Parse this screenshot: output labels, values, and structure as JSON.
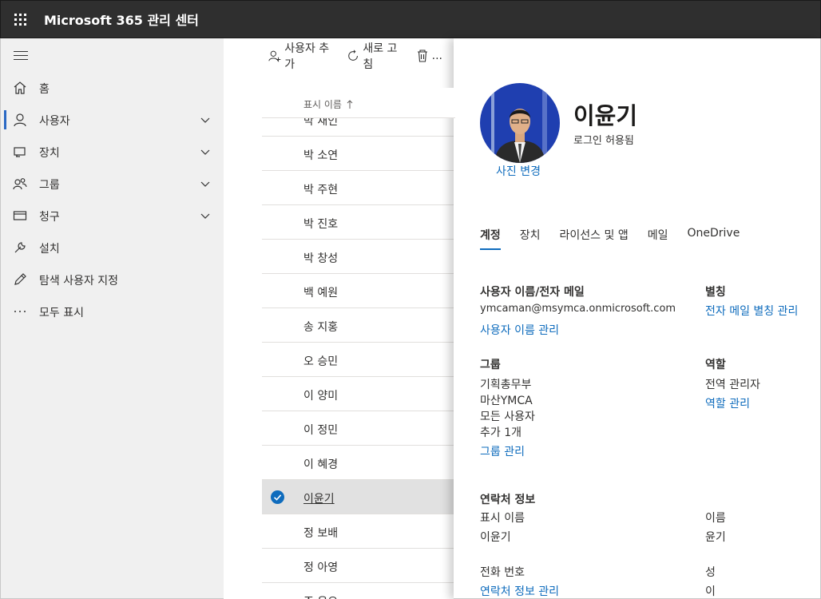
{
  "app": {
    "title": "Microsoft 365 관리 센터"
  },
  "sidebar": {
    "items": [
      {
        "label": "홈",
        "icon": "home-icon"
      },
      {
        "label": "사용자",
        "icon": "person-icon",
        "active": true,
        "expandable": true
      },
      {
        "label": "장치",
        "icon": "device-icon",
        "expandable": true
      },
      {
        "label": "그룹",
        "icon": "group-icon",
        "expandable": true
      },
      {
        "label": "청구",
        "icon": "billing-icon",
        "expandable": true
      },
      {
        "label": "설치",
        "icon": "wrench-icon"
      },
      {
        "label": "탐색 사용자 지정",
        "icon": "pencil-icon"
      },
      {
        "label": "모두 표시",
        "icon": "more-icon"
      }
    ]
  },
  "toolbar": {
    "add_user": "사용자 추가",
    "refresh": "새로 고침",
    "delete": "..."
  },
  "list": {
    "column_header": "표시 이름",
    "rows": [
      "박 재인",
      "박 소연",
      "박 주현",
      "박 진호",
      "박 창성",
      "백 예원",
      "송 지홍",
      "오 승민",
      "이 양미",
      "이 정민",
      "이 혜경",
      "이윤기",
      "정 보배",
      "정 아영",
      "조 은오"
    ],
    "selected_index": 11
  },
  "panel": {
    "user_name": "이윤기",
    "status": "로그인 허용됨",
    "change_photo": "사진 변경",
    "tabs": [
      "계정",
      "장치",
      "라이선스 및 앱",
      "메일",
      "OneDrive"
    ],
    "active_tab": "계정",
    "username_email": {
      "title": "사용자 이름/전자 메일",
      "value": "ymcaman@msymca.onmicrosoft.com",
      "link": "사용자 이름 관리"
    },
    "alias": {
      "title": "별칭",
      "link": "전자 메일 별칭 관리"
    },
    "groups": {
      "title": "그룹",
      "items": [
        "기획총무부",
        "마산YMCA",
        "모든 사용자",
        "추가 1개"
      ],
      "link": "그룹 관리"
    },
    "roles": {
      "title": "역할",
      "value": "전역 관리자",
      "link": "역할 관리"
    },
    "contact": {
      "title": "연락처 정보",
      "display_name_label": "표시 이름",
      "display_name_value": "이윤기",
      "first_name_label": "이름",
      "first_name_value": "윤기",
      "phone_label": "전화 번호",
      "last_name_label": "성",
      "last_name_value": "이",
      "link": "연락처 정보 관리"
    }
  }
}
